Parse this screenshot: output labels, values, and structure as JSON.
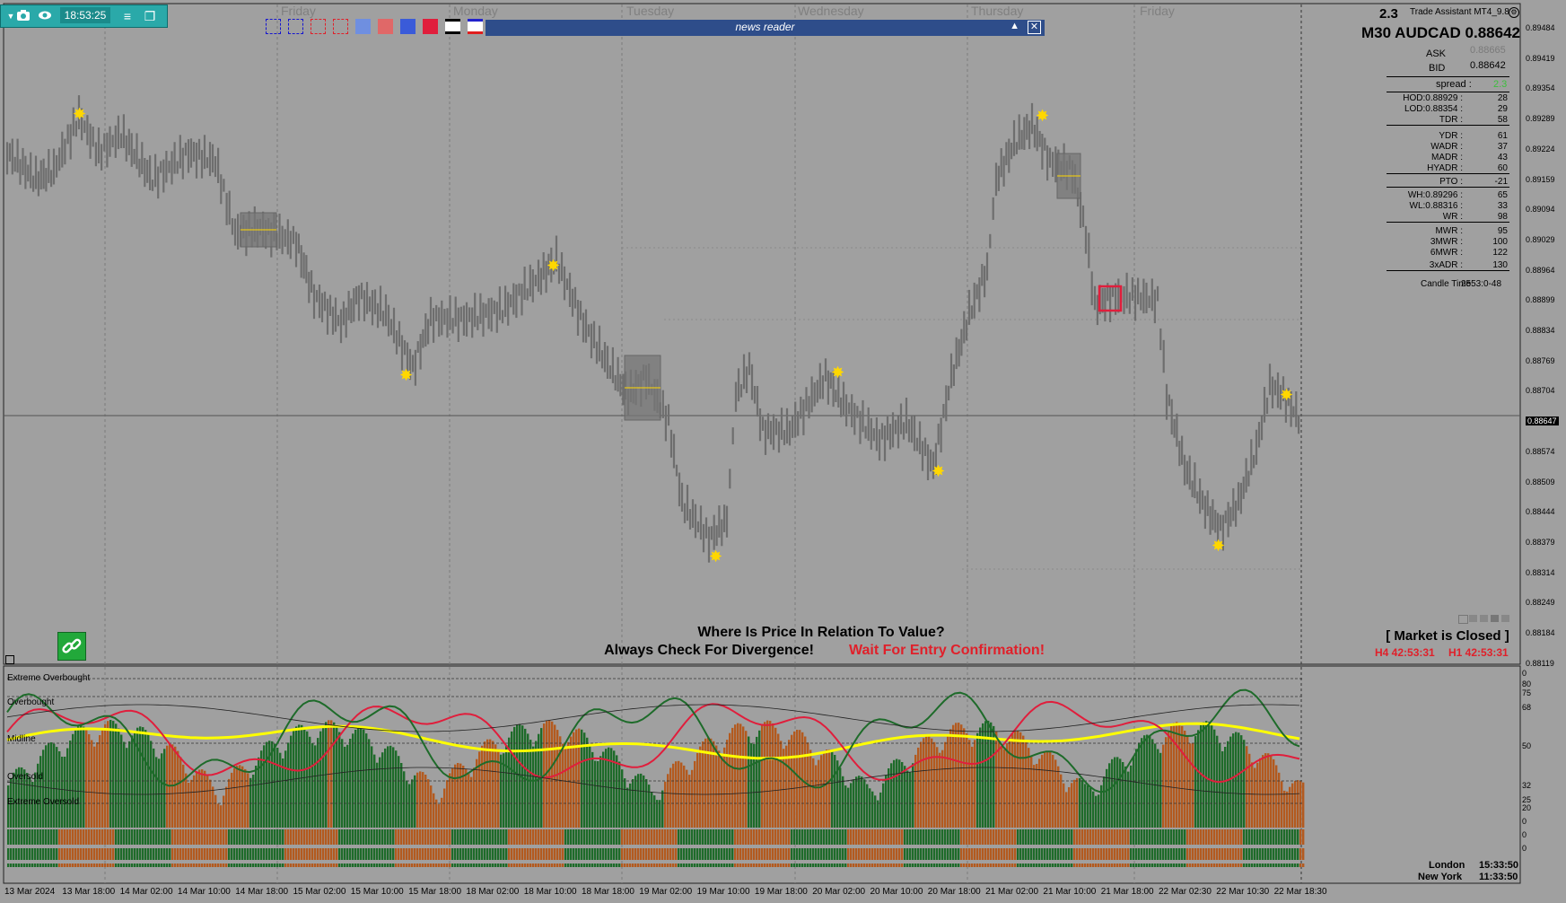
{
  "toolbar": {
    "time": "18:53:25",
    "camera_icon": "camera-icon",
    "eye_icon": "eye-icon",
    "menu_icon": "menu-icon",
    "window_icon": "window-icon"
  },
  "news": {
    "title": "news reader"
  },
  "day_labels": [
    "Friday",
    "Monday",
    "Tuesday",
    "Wednesday",
    "Thursday",
    "Friday"
  ],
  "panel": {
    "version": "2.3",
    "app": "Trade Assistant MT4_9.8",
    "symbol": "M30 AUDCAD 0.88642",
    "ask_label": "ASK",
    "ask": "0.88665",
    "bid_label": "BID",
    "bid": "0.88642",
    "spread_label": "spread :",
    "spread": "2.3",
    "rows": [
      {
        "label": "HOD:0.88929 :",
        "value": "28"
      },
      {
        "label": "LOD:0.88354 :",
        "value": "29"
      },
      {
        "label": "TDR :",
        "value": "58"
      },
      {
        "label": "YDR :",
        "value": "61"
      },
      {
        "label": "WADR :",
        "value": "37"
      },
      {
        "label": "MADR :",
        "value": "43"
      },
      {
        "label": "HYADR :",
        "value": "60"
      },
      {
        "label": "PTO :",
        "value": "-21"
      },
      {
        "label": "WH:0.89296 :",
        "value": "65"
      },
      {
        "label": "WL:0.88316 :",
        "value": "33"
      },
      {
        "label": "WR :",
        "value": "98"
      },
      {
        "label": "MWR :",
        "value": "95"
      },
      {
        "label": "3MWR :",
        "value": "100"
      },
      {
        "label": "6MWR :",
        "value": "122"
      },
      {
        "label": "3xADR :",
        "value": "130"
      }
    ],
    "candle_time_label": "Candle Time",
    "candle_time": "2553:0-48"
  },
  "price_axis": [
    "0.89484",
    "0.89419",
    "0.89354",
    "0.89289",
    "0.89224",
    "0.89159",
    "0.89094",
    "0.89029",
    "0.88964",
    "0.88899",
    "0.88834",
    "0.88769",
    "0.88704",
    "0.88647",
    "0.88574",
    "0.88509",
    "0.88444",
    "0.88379",
    "0.88314",
    "0.88249",
    "0.88184",
    "0.88119"
  ],
  "current_price": "0.88647",
  "messages": {
    "line1": "Where Is Price In Relation To Value?",
    "line2": "Always Check For Divergence!",
    "line3": "Wait For Entry Confirmation!",
    "market": "[ Market is Closed ]",
    "h4": "H4 42:53:31",
    "h1": "H1 42:53:31"
  },
  "osc_labels": [
    "Extreme Overbought",
    "Overbought",
    "Midline",
    "Oversold",
    "Extreme Oversold"
  ],
  "osc_axis": [
    "0",
    "80",
    "75",
    "68",
    "50",
    "32",
    "25",
    "20",
    "0",
    "0",
    "0"
  ],
  "sessions": [
    {
      "name": "London",
      "time": "15:33:50"
    },
    {
      "name": "New York",
      "time": "11:33:50"
    }
  ],
  "time_axis": [
    "13 Mar 2024",
    "13 Mar 18:00",
    "14 Mar 02:00",
    "14 Mar 10:00",
    "14 Mar 18:00",
    "15 Mar 02:00",
    "15 Mar 10:00",
    "15 Mar 18:00",
    "18 Mar 02:00",
    "18 Mar 10:00",
    "18 Mar 18:00",
    "19 Mar 02:00",
    "19 Mar 10:00",
    "19 Mar 18:00",
    "20 Mar 02:00",
    "20 Mar 10:00",
    "20 Mar 18:00",
    "21 Mar 02:00",
    "21 Mar 10:00",
    "21 Mar 18:00",
    "22 Mar 02:30",
    "22 Mar 10:30",
    "22 Mar 18:30"
  ],
  "colors": {
    "bg": "#a0a0a0",
    "candle": "#6e6e6e",
    "star": "#ffd700",
    "news": "#2e4d8a",
    "red": "#e0202a",
    "yellow": "#ffff00",
    "green": "#1e6b2a",
    "orange": "#b35a1f"
  }
}
